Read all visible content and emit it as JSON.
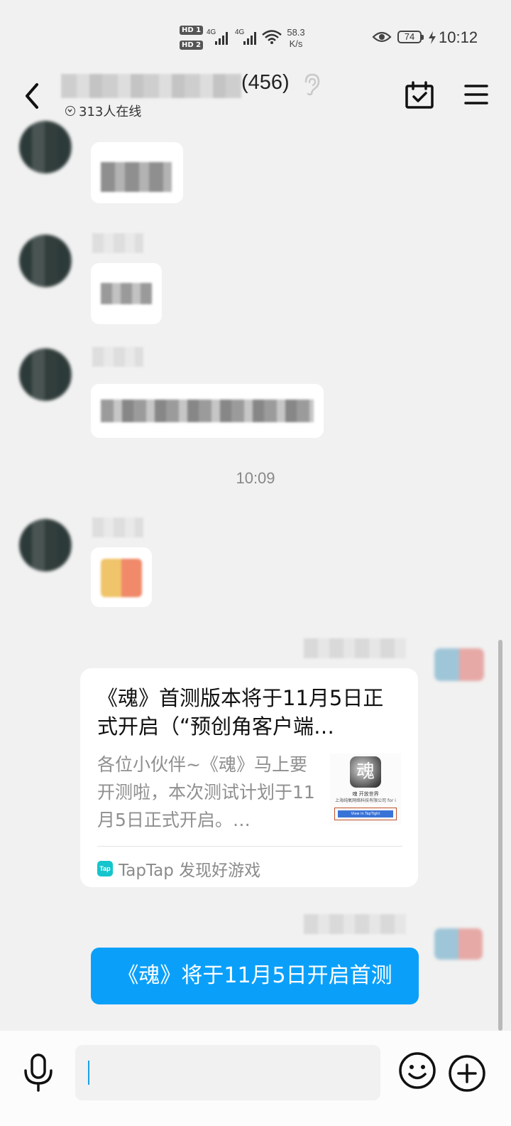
{
  "status_bar": {
    "hd1": "HD 1",
    "hd2": "HD 2",
    "net_type": "4G",
    "net_speed_value": "58.3",
    "net_speed_unit": "K/s",
    "battery": "74",
    "time": "10:12"
  },
  "header": {
    "group_name_suffix": "(456)",
    "online_count": "313人在线",
    "icons": [
      "back-arrow-icon",
      "ear-icon",
      "calendar-check-icon",
      "menu-icon"
    ]
  },
  "chat": {
    "timestamp": "10:09",
    "link_card": {
      "title": "《魂》首测版本将于11月5日正式开启（“预创角客户端…",
      "description": "各位小伙伴~《魂》马上要开测啦，本次测试计划于11月5日正式开启。…",
      "thumb_title": "魂 开放世界",
      "thumb_company": "上海纯氧网络科技有限公司 for i",
      "thumb_button": "View in TapTight",
      "source_logo": "Tap",
      "source": "TapTap 发现好游戏"
    },
    "sent_message": "《魂》将于11月5日开启首测"
  },
  "input_bar": {
    "icons": [
      "microphone-icon",
      "emoji-icon",
      "plus-icon"
    ],
    "input_value": ""
  },
  "colors": {
    "accent": "#0aa0fa",
    "background": "#f1f1f1",
    "taptap": "#15c5ce"
  }
}
